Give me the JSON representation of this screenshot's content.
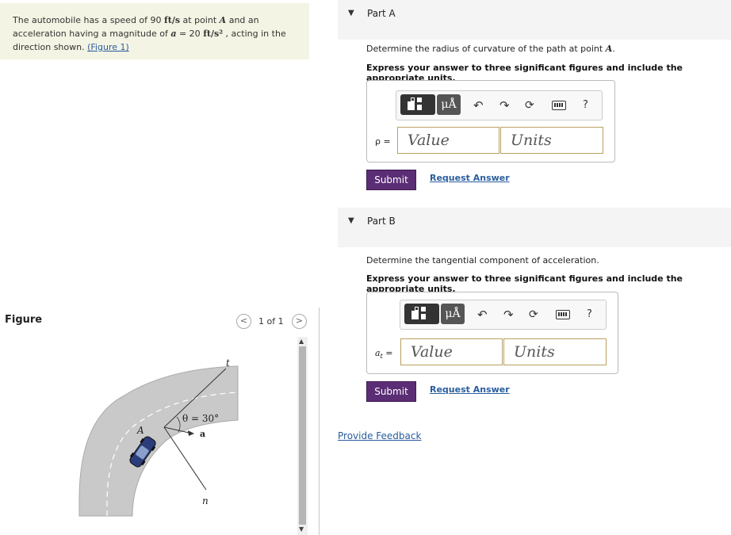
{
  "problem": {
    "t1": "The automobile has a speed of 90 ",
    "unit_speed": "ft/s",
    "t2": " at point ",
    "point": "A",
    "t3": " and an acceleration having a magnitude of ",
    "a_var": "a",
    "t4": " = 20 ",
    "unit_acc": "ft/s²",
    "t5": " , acting in the direction shown. ",
    "figure_link": "(Figure 1)"
  },
  "partA": {
    "label": "Part A",
    "question_pre": "Determine the radius of curvature of the path at point ",
    "question_point": "A",
    "question_post": ".",
    "instruction": "Express your answer to three significant figures and include the appropriate units.",
    "var": "ρ =",
    "value_placeholder": "Value",
    "units_placeholder": "Units",
    "submit": "Submit",
    "request": "Request Answer"
  },
  "partB": {
    "label": "Part B",
    "question": "Determine the tangential component of acceleration.",
    "instruction": "Express your answer to three significant figures and include the appropriate units.",
    "var_main": "a",
    "var_sub": "t",
    "var_eq": " =",
    "value_placeholder": "Value",
    "units_placeholder": "Units",
    "submit": "Submit",
    "request": "Request Answer"
  },
  "toolbar": {
    "mu_label": "μÅ",
    "undo_icon": "undo-icon",
    "redo_icon": "redo-icon",
    "reset_icon": "reset-icon",
    "keyboard_icon": "keyboard-icon",
    "help_label": "?"
  },
  "feedback": "Provide Feedback",
  "figure": {
    "label": "Figure",
    "counter": "1 of 1",
    "prev": "<",
    "next": ">",
    "t": "t",
    "n": "n",
    "A": "A",
    "theta": "θ = 30°",
    "a": "a"
  }
}
